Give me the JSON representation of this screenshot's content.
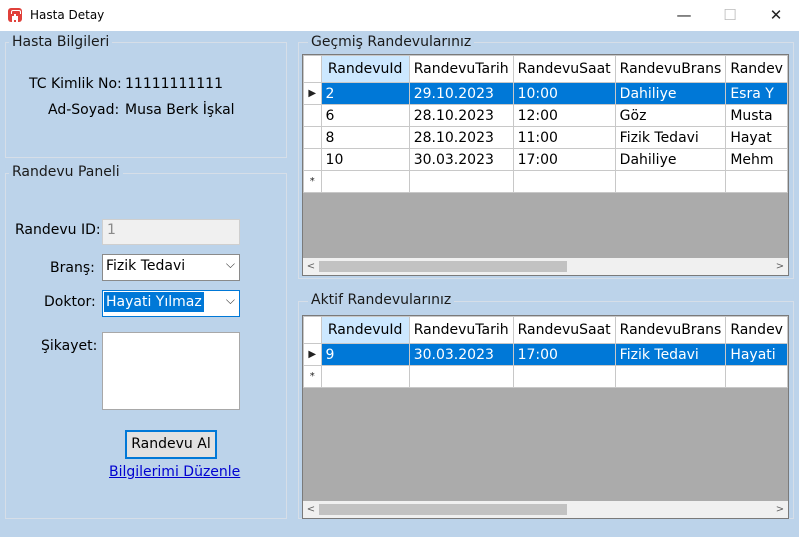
{
  "window": {
    "title": "Hasta Detay",
    "minimize": "—",
    "maximize": "☐",
    "close": "✕"
  },
  "patient": {
    "group_title": "Hasta Bilgileri",
    "tc_label": "TC Kimlik No:",
    "tc_value": "11111111111",
    "name_label": "Ad-Soyad:",
    "name_value": "Musa Berk İşkal"
  },
  "panel": {
    "group_title": "Randevu Paneli",
    "id_label": "Randevu ID:",
    "id_value": "1",
    "brans_label": "Branş:",
    "brans_value": "Fizik Tedavi",
    "doktor_label": "Doktor:",
    "doktor_value": "Hayati Yılmaz",
    "sikayet_label": "Şikayet:",
    "sikayet_value": "",
    "submit_label": "Randevu Al",
    "edit_link": "Bilgilerimi Düzenle"
  },
  "past": {
    "group_title": "Geçmiş Randevularınız",
    "columns": [
      "RandevuId",
      "RandevuTarih",
      "RandevuSaat",
      "RandevuBrans",
      "Randev"
    ],
    "rows": [
      [
        "2",
        "29.10.2023",
        "10:00",
        "Dahiliye",
        "Esra Y"
      ],
      [
        "6",
        "28.10.2023",
        "12:00",
        "Göz",
        "Musta"
      ],
      [
        "8",
        "28.10.2023",
        "11:00",
        "Fizik Tedavi",
        "Hayat"
      ],
      [
        "10",
        "30.03.2023",
        "17:00",
        "Dahiliye",
        "Mehm"
      ]
    ]
  },
  "active": {
    "group_title": "Aktif Randevularınız",
    "columns": [
      "RandevuId",
      "RandevuTarih",
      "RandevuSaat",
      "RandevuBrans",
      "Randev"
    ],
    "rows": [
      [
        "9",
        "30.03.2023",
        "17:00",
        "Fizik Tedavi",
        "Hayati"
      ]
    ]
  },
  "icons": {
    "current_row": "▶",
    "new_row": "*",
    "scroll_left": "<",
    "scroll_right": ">",
    "dropdown": "⌵"
  },
  "colors": {
    "background": "#bcd3ea",
    "selection": "#0078d7",
    "grid_empty": "#ababab",
    "link": "#0000d0"
  }
}
